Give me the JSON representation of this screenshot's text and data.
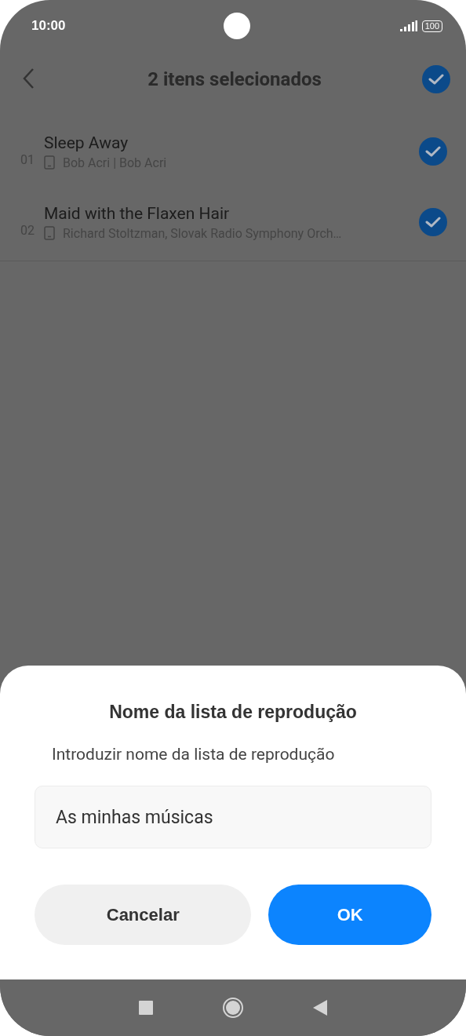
{
  "status_bar": {
    "time": "10:00",
    "battery": "100"
  },
  "header": {
    "title": "2 itens selecionados",
    "all_selected": true
  },
  "songs": [
    {
      "number": "01",
      "title": "Sleep Away",
      "subtitle": "Bob Acri | Bob Acri",
      "selected": true
    },
    {
      "number": "02",
      "title": "Maid with the Flaxen Hair",
      "subtitle": "Richard Stoltzman, Slovak Radio Symphony Orch…",
      "selected": true
    }
  ],
  "dialog": {
    "title": "Nome da lista de reprodução",
    "label": "Introduzir nome da lista de reprodução",
    "field": {
      "value": "As minhas músicas"
    },
    "buttons": [
      {
        "label": "Cancelar",
        "kind": "secondary"
      },
      {
        "label": "OK",
        "kind": "primary"
      }
    ]
  }
}
